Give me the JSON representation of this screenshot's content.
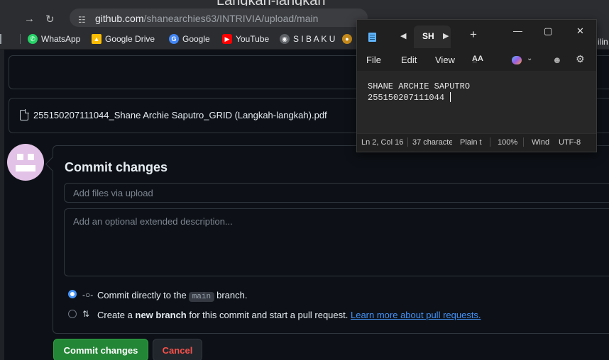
{
  "browser": {
    "top_partial_text": "Langkah-langkah",
    "back_icon": "back-arrow-icon",
    "forward_icon": "forward-arrow-icon",
    "reload_icon": "reload-icon",
    "site_info_icon": "site-settings-icon",
    "url_host": "github.com",
    "url_path": "/shanearchies63/INTRIVIA/upload/main"
  },
  "bookmarks": [
    {
      "label": "WhatsApp",
      "icon": "whatsapp-icon",
      "color": "#25d366"
    },
    {
      "label": "Google Drive",
      "icon": "google-drive-icon",
      "color": "#fbbc04"
    },
    {
      "label": "Google",
      "icon": "google-icon",
      "color": "#4285f4"
    },
    {
      "label": "YouTube",
      "icon": "youtube-icon",
      "color": "#ff0000"
    },
    {
      "label": "S I B A K U",
      "icon": "sibaku-icon",
      "color": "#9aa0a6"
    }
  ],
  "bookmarks_tail": "ilin",
  "upload": {
    "file_name": "255150207111044_Shane Archie Saputro_GRID (Langkah-langkah).pdf"
  },
  "commit": {
    "title": "Commit changes",
    "summary_placeholder": "Add files via upload",
    "description_placeholder": "Add an optional extended description...",
    "option_direct_prefix": "Commit directly to the",
    "branch_name": "main",
    "option_direct_suffix": "branch.",
    "option_new_prefix": "Create a",
    "option_new_bold": "new branch",
    "option_new_suffix": "for this commit and start a pull request.",
    "learn_more_link": "Learn more about pull requests.",
    "commit_button": "Commit changes",
    "cancel_button": "Cancel",
    "accent_color": "#238636",
    "link_color": "#4493f8"
  },
  "notepad": {
    "tab_title": "SH",
    "new_tab": "+",
    "minimize": "—",
    "maximize": "▢",
    "close": "✕",
    "menu": [
      "File",
      "Edit",
      "View"
    ],
    "format_label": "A̲A",
    "text_lines": [
      "SHANE ARCHIE SAPUTRO",
      "255150207111044"
    ],
    "status": {
      "position": "Ln 2, Col 16",
      "characters": "37 characte",
      "format": "Plain t",
      "zoom": "100%",
      "line_ending": "Wind",
      "encoding": "UTF-8"
    }
  }
}
